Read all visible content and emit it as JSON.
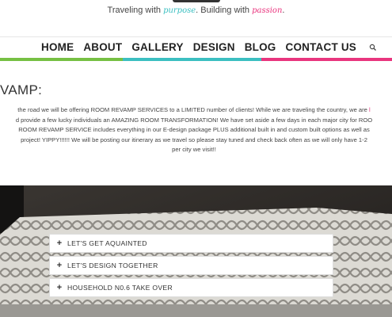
{
  "header": {
    "tagline_part1": "Traveling with ",
    "tagline_accent1": "purpose",
    "tagline_part2": ". Building with ",
    "tagline_accent2": "passion",
    "tagline_end": "."
  },
  "nav": {
    "items": [
      "HOME",
      "ABOUT",
      "GALLERY",
      "DESIGN",
      "BLOG",
      "CONTACT US"
    ],
    "search_icon": "search-icon"
  },
  "colors": {
    "green": "#76c043",
    "teal": "#3bbfc1",
    "pink": "#e9357e",
    "charcoal": "#2b2b2b"
  },
  "content": {
    "title": "VAMP:",
    "para_1": "the road we will be offering ROOM REVAMP SERVICES to a LIMITED number of clients! While we are traveling the country, we are ",
    "para_1_hl": "l",
    "para_2": "d provide a few lucky individuals an AMAZING ROOM TRANSFORMATION! We have set aside a few days in each major city for ROO",
    "para_3": "ROOM REVAMP SERVICE includes everything in our E-design package PLUS additional built in and custom built options as well as",
    "para_4": "project! YIPPY!!!!!!  We will be posting our itinerary as we travel so please stay tuned and check back often as we will only have 1-2",
    "para_5": "per city we visit!!"
  },
  "accordion": {
    "items": [
      "LET'S GET AQUAINTED",
      "LET'S DESIGN TOGETHER",
      "HOUSEHOLD N0.6 TAKE OVER"
    ]
  }
}
